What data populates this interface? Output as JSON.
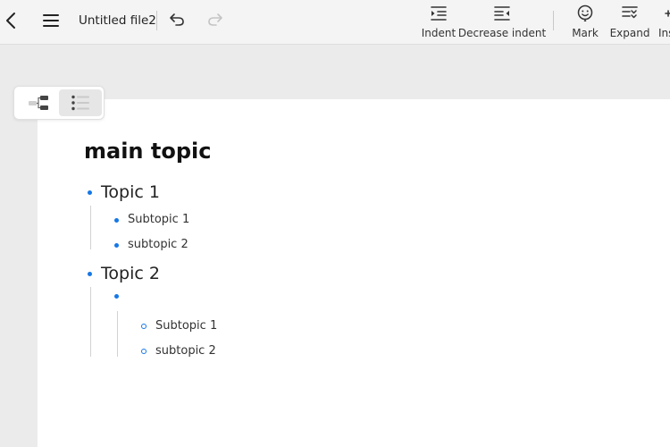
{
  "toolbar": {
    "file_title": "Untitled file2",
    "back_icon": "chevron-left-icon",
    "menu_icon": "hamburger-menu-icon",
    "undo_icon": "undo-icon",
    "redo_icon": "redo-icon",
    "tools": [
      {
        "label": "Indent",
        "icon": "indent-icon"
      },
      {
        "label": "Decrease indent",
        "icon": "outdent-icon"
      },
      {
        "label": "Mark",
        "icon": "smiley-mark-icon"
      },
      {
        "label": "Expand",
        "icon": "expand-icon"
      },
      {
        "label": "Ins",
        "icon": "insert-icon"
      }
    ]
  },
  "view_switch": {
    "options": [
      "mind-map-view-icon",
      "outline-view-icon"
    ],
    "active": "outline-view-icon"
  },
  "outline": {
    "title": "main topic",
    "topics": [
      {
        "label": "Topic 1",
        "children": [
          {
            "label": "Subtopic 1"
          },
          {
            "label": "subtopic 2"
          }
        ]
      },
      {
        "label": "Topic 2",
        "children": [
          {
            "label": "",
            "children": [
              {
                "label": "Subtopic 1"
              },
              {
                "label": "subtopic 2"
              }
            ]
          }
        ]
      }
    ]
  },
  "colors": {
    "accent": "#1677e6",
    "toolbar_bg": "#f4f4f4",
    "canvas_bg": "#ebebeb",
    "page_bg": "#ffffff"
  }
}
